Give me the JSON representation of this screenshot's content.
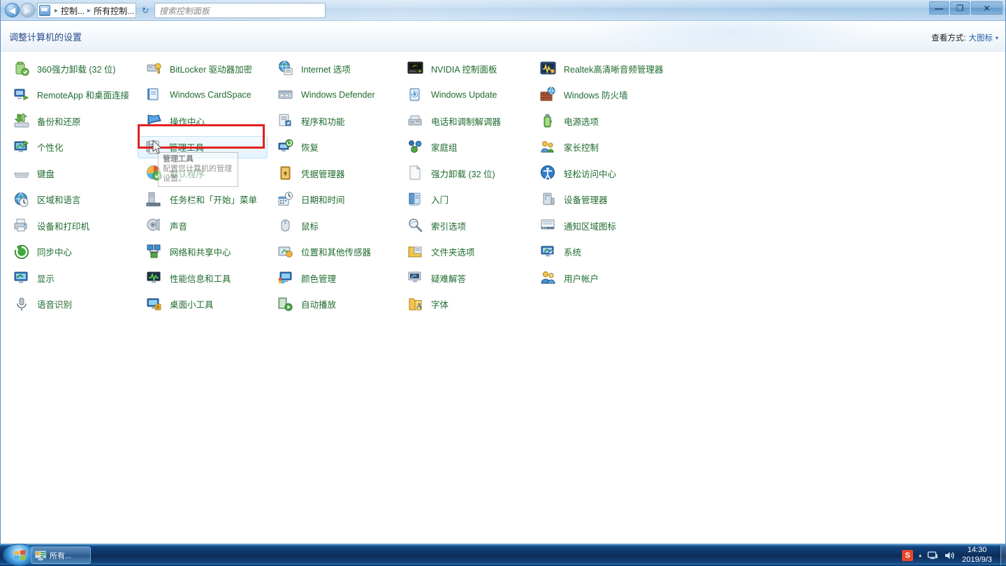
{
  "window": {
    "nav": {
      "back_icon": "back-arrow-icon",
      "forward_icon": "forward-arrow-icon"
    },
    "address": {
      "icon": "control-panel-icon",
      "crumbs": [
        "控制...",
        "所有控制..."
      ],
      "separator": "▸",
      "dropdown_caret": "▾"
    },
    "refresh_icon": "refresh-icon",
    "search": {
      "placeholder": "搜索控制面板"
    },
    "controls": {
      "minimize_label": "—",
      "maximize_label": "❐",
      "close_label": "✕"
    }
  },
  "header": {
    "title": "调整计算机的设置",
    "view_by_label": "查看方式:",
    "view_by_value": "大图标",
    "view_by_caret": "▾"
  },
  "columns": [
    {
      "items": [
        {
          "label": "360强力卸载 (32 位)",
          "icon": "uninstall-360-icon"
        },
        {
          "label": "RemoteApp 和桌面连接",
          "icon": "remoteapp-icon"
        },
        {
          "label": "备份和还原",
          "icon": "backup-restore-icon"
        },
        {
          "label": "个性化",
          "icon": "personalization-icon"
        },
        {
          "label": "键盘",
          "icon": "keyboard-icon"
        },
        {
          "label": "区域和语言",
          "icon": "region-language-icon"
        },
        {
          "label": "设备和打印机",
          "icon": "devices-printers-icon"
        },
        {
          "label": "同步中心",
          "icon": "sync-center-icon"
        },
        {
          "label": "显示",
          "icon": "display-icon"
        },
        {
          "label": "语音识别",
          "icon": "speech-recognition-icon"
        }
      ]
    },
    {
      "items": [
        {
          "label": "BitLocker 驱动器加密",
          "icon": "bitlocker-icon"
        },
        {
          "label": "Windows CardSpace",
          "icon": "cardspace-icon"
        },
        {
          "label": "操作中心",
          "icon": "action-center-icon"
        },
        {
          "label": "管理工具",
          "icon": "admin-tools-icon",
          "hovered": true
        },
        {
          "label": "默认程序",
          "icon": "default-programs-icon"
        },
        {
          "label": "任务栏和「开始」菜单",
          "icon": "taskbar-startmenu-icon"
        },
        {
          "label": "声音",
          "icon": "sound-icon"
        },
        {
          "label": "网络和共享中心",
          "icon": "network-sharing-icon"
        },
        {
          "label": "性能信息和工具",
          "icon": "performance-tools-icon"
        },
        {
          "label": "桌面小工具",
          "icon": "desktop-gadgets-icon"
        }
      ]
    },
    {
      "items": [
        {
          "label": "Internet 选项",
          "icon": "internet-options-icon"
        },
        {
          "label": "Windows Defender",
          "icon": "windows-defender-icon"
        },
        {
          "label": "程序和功能",
          "icon": "programs-features-icon"
        },
        {
          "label": "恢复",
          "icon": "recovery-icon"
        },
        {
          "label": "凭据管理器",
          "icon": "credential-manager-icon"
        },
        {
          "label": "日期和时间",
          "icon": "date-time-icon"
        },
        {
          "label": "鼠标",
          "icon": "mouse-icon"
        },
        {
          "label": "位置和其他传感器",
          "icon": "location-sensors-icon"
        },
        {
          "label": "颜色管理",
          "icon": "color-management-icon"
        },
        {
          "label": "自动播放",
          "icon": "autoplay-icon"
        }
      ]
    },
    {
      "items": [
        {
          "label": "NVIDIA 控制面板",
          "icon": "nvidia-control-panel-icon"
        },
        {
          "label": "Windows Update",
          "icon": "windows-update-icon"
        },
        {
          "label": "电话和调制解调器",
          "icon": "phone-modem-icon"
        },
        {
          "label": "家庭组",
          "icon": "homegroup-icon"
        },
        {
          "label": "强力卸载 (32 位)",
          "icon": "force-uninstall-icon"
        },
        {
          "label": "入门",
          "icon": "getting-started-icon"
        },
        {
          "label": "索引选项",
          "icon": "indexing-options-icon"
        },
        {
          "label": "文件夹选项",
          "icon": "folder-options-icon"
        },
        {
          "label": "疑难解答",
          "icon": "troubleshooting-icon"
        },
        {
          "label": "字体",
          "icon": "fonts-icon"
        }
      ]
    },
    {
      "items": [
        {
          "label": "Realtek高清晰音频管理器",
          "icon": "realtek-audio-icon"
        },
        {
          "label": "Windows 防火墙",
          "icon": "windows-firewall-icon"
        },
        {
          "label": "电源选项",
          "icon": "power-options-icon"
        },
        {
          "label": "家长控制",
          "icon": "parental-controls-icon"
        },
        {
          "label": "轻松访问中心",
          "icon": "ease-of-access-icon"
        },
        {
          "label": "设备管理器",
          "icon": "device-manager-icon"
        },
        {
          "label": "通知区域图标",
          "icon": "notification-area-icons-icon"
        },
        {
          "label": "系统",
          "icon": "system-icon"
        },
        {
          "label": "用户帐户",
          "icon": "user-accounts-icon"
        }
      ]
    }
  ],
  "tooltip": {
    "title": "管理工具",
    "body": "配置您计算机的管理设置。"
  },
  "annotation": {
    "color": "#e32020"
  },
  "taskbar": {
    "start_icon": "windows-start-orb-icon",
    "task_button": {
      "label": "所有...",
      "icon": "control-panel-icon"
    },
    "tray": {
      "ime_icon": "sogou-ime-icon",
      "ime_label": "S",
      "overflow_caret": "▴",
      "network_icon": "network-icon",
      "volume_icon": "volume-icon",
      "time": "14:30",
      "date": "2019/9/3"
    }
  }
}
